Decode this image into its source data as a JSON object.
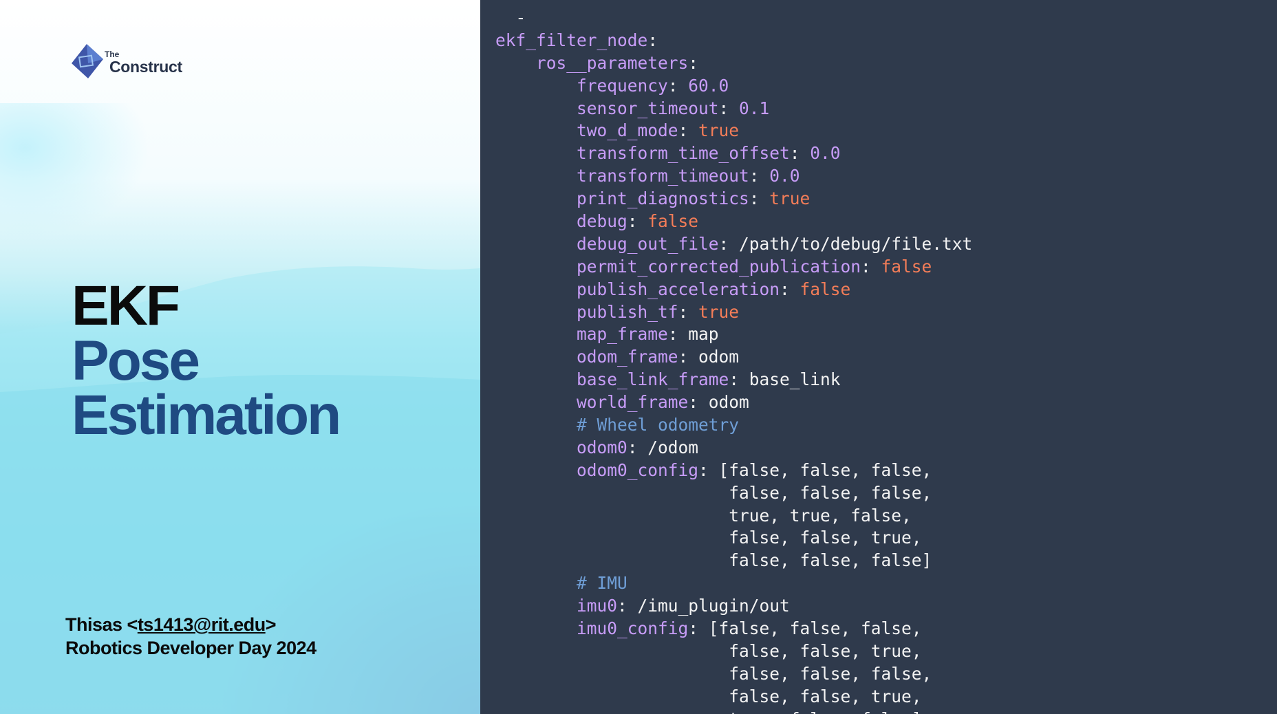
{
  "logo": {
    "small": "The",
    "big": "Construct"
  },
  "title": {
    "line1": "EKF",
    "line2": "Pose",
    "line3": "Estimation"
  },
  "author": {
    "name_prefix": "Thisas <",
    "email": "ts1413@rit.edu",
    "name_suffix": ">",
    "event": "Robotics Developer Day 2024"
  },
  "colors": {
    "code_background": "#2f3a4c",
    "key": "#c79cf7",
    "boolean": "#f47d58",
    "comment": "#6f9ed6",
    "plain": "#f3f3f3",
    "title_dark": "#0b0b0b",
    "title_blue": "#1f4a82"
  },
  "code": [
    [
      {
        "t": "  -",
        "c": "p"
      }
    ],
    [
      {
        "t": "ekf_filter_node",
        "c": "k"
      },
      {
        "t": ":",
        "c": "p"
      }
    ],
    [
      {
        "t": "    ros__parameters",
        "c": "k"
      },
      {
        "t": ":",
        "c": "p"
      }
    ],
    [
      {
        "t": "        frequency",
        "c": "k"
      },
      {
        "t": ": ",
        "c": "p"
      },
      {
        "t": "60.0",
        "c": "n"
      }
    ],
    [
      {
        "t": "        sensor_timeout",
        "c": "k"
      },
      {
        "t": ": ",
        "c": "p"
      },
      {
        "t": "0.1",
        "c": "n"
      }
    ],
    [
      {
        "t": "        two_d_mode",
        "c": "k"
      },
      {
        "t": ": ",
        "c": "p"
      },
      {
        "t": "true",
        "c": "b"
      }
    ],
    [
      {
        "t": "        transform_time_offset",
        "c": "k"
      },
      {
        "t": ": ",
        "c": "p"
      },
      {
        "t": "0.0",
        "c": "n"
      }
    ],
    [
      {
        "t": "        transform_timeout",
        "c": "k"
      },
      {
        "t": ": ",
        "c": "p"
      },
      {
        "t": "0.0",
        "c": "n"
      }
    ],
    [
      {
        "t": "        print_diagnostics",
        "c": "k"
      },
      {
        "t": ": ",
        "c": "p"
      },
      {
        "t": "true",
        "c": "b"
      }
    ],
    [
      {
        "t": "        debug",
        "c": "k"
      },
      {
        "t": ": ",
        "c": "p"
      },
      {
        "t": "false",
        "c": "b"
      }
    ],
    [
      {
        "t": "        debug_out_file",
        "c": "k"
      },
      {
        "t": ": ",
        "c": "p"
      },
      {
        "t": "/path/to/debug/file.txt",
        "c": "s"
      }
    ],
    [
      {
        "t": "        permit_corrected_publication",
        "c": "k"
      },
      {
        "t": ": ",
        "c": "p"
      },
      {
        "t": "false",
        "c": "b"
      }
    ],
    [
      {
        "t": "        publish_acceleration",
        "c": "k"
      },
      {
        "t": ": ",
        "c": "p"
      },
      {
        "t": "false",
        "c": "b"
      }
    ],
    [
      {
        "t": "        publish_tf",
        "c": "k"
      },
      {
        "t": ": ",
        "c": "p"
      },
      {
        "t": "true",
        "c": "b"
      }
    ],
    [
      {
        "t": "        map_frame",
        "c": "k"
      },
      {
        "t": ": ",
        "c": "p"
      },
      {
        "t": "map",
        "c": "s"
      }
    ],
    [
      {
        "t": "        odom_frame",
        "c": "k"
      },
      {
        "t": ": ",
        "c": "p"
      },
      {
        "t": "odom",
        "c": "s"
      }
    ],
    [
      {
        "t": "        base_link_frame",
        "c": "k"
      },
      {
        "t": ": ",
        "c": "p"
      },
      {
        "t": "base_link",
        "c": "s"
      }
    ],
    [
      {
        "t": "        world_frame",
        "c": "k"
      },
      {
        "t": ": ",
        "c": "p"
      },
      {
        "t": "odom",
        "c": "s"
      }
    ],
    [
      {
        "t": "        # Wheel odometry",
        "c": "c"
      }
    ],
    [
      {
        "t": "        odom0",
        "c": "k"
      },
      {
        "t": ": ",
        "c": "p"
      },
      {
        "t": "/odom",
        "c": "s"
      }
    ],
    [
      {
        "t": "        odom0_config",
        "c": "k"
      },
      {
        "t": ": [false, false, false,",
        "c": "p"
      }
    ],
    [
      {
        "t": "                       false, false, false,",
        "c": "p"
      }
    ],
    [
      {
        "t": "                       true, true, false,",
        "c": "p"
      }
    ],
    [
      {
        "t": "                       false, false, true,",
        "c": "p"
      }
    ],
    [
      {
        "t": "                       false, false, false]",
        "c": "p"
      }
    ],
    [
      {
        "t": "        # IMU",
        "c": "c"
      }
    ],
    [
      {
        "t": "        imu0",
        "c": "k"
      },
      {
        "t": ": ",
        "c": "p"
      },
      {
        "t": "/imu_plugin/out",
        "c": "s"
      }
    ],
    [
      {
        "t": "        imu0_config",
        "c": "k"
      },
      {
        "t": ": [false, false, false,",
        "c": "p"
      }
    ],
    [
      {
        "t": "                       false, false, true,",
        "c": "p"
      }
    ],
    [
      {
        "t": "                       false, false, false,",
        "c": "p"
      }
    ],
    [
      {
        "t": "                       false, false, true,",
        "c": "p"
      }
    ],
    [
      {
        "t": "                       true, false, false]",
        "c": "p"
      }
    ]
  ]
}
